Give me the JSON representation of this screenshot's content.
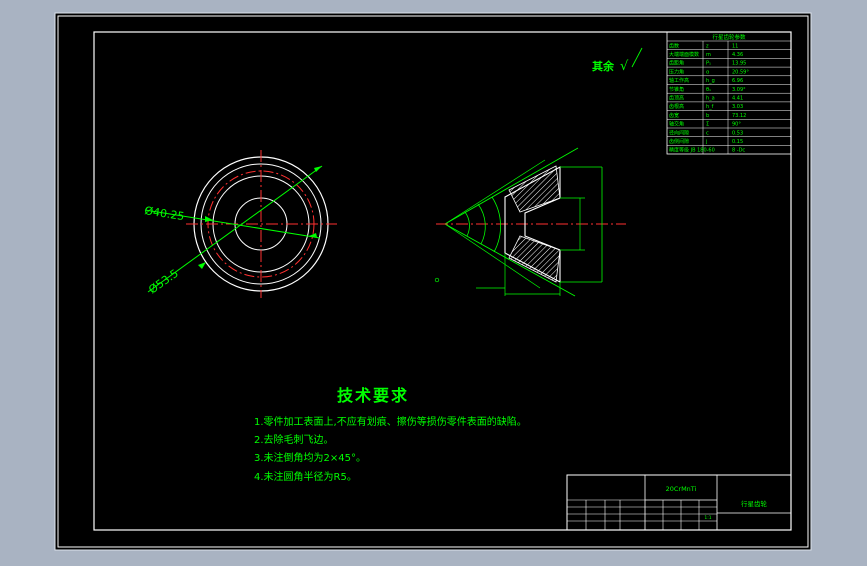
{
  "colors": {
    "viewport_bg": "#a9b3c2",
    "sheet_bg": "#000000",
    "outline": "#ffffff",
    "dimension": "#00ff00",
    "centerline": "#ff0000",
    "hatch": "#ffffff",
    "table_text": "#00ff00"
  },
  "front_view": {
    "dim_inner": "Ø40.25",
    "dim_outer": "Ø53.5"
  },
  "surface_finish": {
    "label": "其余",
    "symbol": "√"
  },
  "param_table": {
    "title": "行星齿轮参数",
    "rows": [
      {
        "name": "齿数",
        "symbol": "z",
        "value": "11"
      },
      {
        "name": "大端端面模数",
        "symbol": "m",
        "value": "4.36"
      },
      {
        "name": "齿距角",
        "symbol": "P₁",
        "value": "13.95"
      },
      {
        "name": "压力角",
        "symbol": "α",
        "value": "20.59°"
      },
      {
        "name": "轴工作高",
        "symbol": "h_g",
        "value": "6.96"
      },
      {
        "name": "节锥角",
        "symbol": "θ₁",
        "value": "3.09°"
      },
      {
        "name": "齿顶高",
        "symbol": "h_a",
        "value": "4.41"
      },
      {
        "name": "齿根高",
        "symbol": "h_f",
        "value": "3.03"
      },
      {
        "name": "齿宽",
        "symbol": "b",
        "value": "73.12"
      },
      {
        "name": "轴交角",
        "symbol": "Σ",
        "value": "90°"
      },
      {
        "name": "径向间隙",
        "symbol": "c",
        "value": "0.53"
      },
      {
        "name": "齿侧间隙",
        "symbol": "j",
        "value": "0.15"
      },
      {
        "name": "精度等级 JB 180-60",
        "symbol": "",
        "value": "8 -Dc"
      }
    ]
  },
  "tech_requirements": {
    "title": "技术要求",
    "items": [
      "1.零件加工表面上,不应有划痕、擦伤等损伤零件表面的缺陷。",
      "2.去除毛刺飞边。",
      "3.未注倒角均为2×45°。",
      "4.未注圆角半径为R5。"
    ]
  },
  "title_block": {
    "material": "20CrMnTi",
    "part_name": "行星齿轮",
    "scale": "1:1"
  }
}
